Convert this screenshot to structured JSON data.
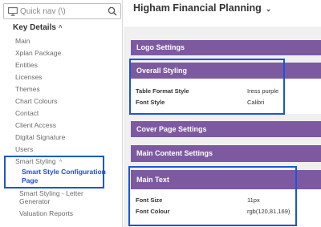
{
  "quick_nav": {
    "placeholder": "Quick nav (\\)"
  },
  "sidebar": {
    "section_title": "Key Details",
    "items": [
      "Main",
      "Xplan Package",
      "Entities",
      "Licenses",
      "Themes",
      "Chart Colours",
      "Contact",
      "Client Access",
      "Digital Signature",
      "Users"
    ],
    "smart_styling": {
      "label": "Smart Styling",
      "active_item_line1": "Smart Style Configuration",
      "active_item_line2": "Page",
      "letter_generator_line1": "Smart Styling - Letter",
      "letter_generator_line2": "Generator",
      "valuation_reports": "Valuation Reports"
    }
  },
  "header": {
    "title": "Higham Financial Planning"
  },
  "sections": {
    "logo": {
      "title": "Logo Settings"
    },
    "overall": {
      "title": "Overall Styling",
      "rows": [
        {
          "label": "Table Format Style",
          "value": "Iress purple"
        },
        {
          "label": "Font Style",
          "value": "Calibri"
        }
      ]
    },
    "cover": {
      "title": "Cover Page Settings"
    },
    "main_content": {
      "title": "Main Content Settings"
    },
    "main_text": {
      "title": "Main Text",
      "rows": [
        {
          "label": "Font Size",
          "value": "11px"
        },
        {
          "label": "Font Colour",
          "value": "rgb(120,81,169)"
        }
      ]
    }
  },
  "colors": {
    "section_header": "#7d5aa0",
    "highlight": "#1a56d6",
    "active_link": "#1e4fd4"
  },
  "icons": [
    "monitor-icon",
    "search-icon",
    "chevron-up-icon",
    "chevron-down-icon"
  ]
}
